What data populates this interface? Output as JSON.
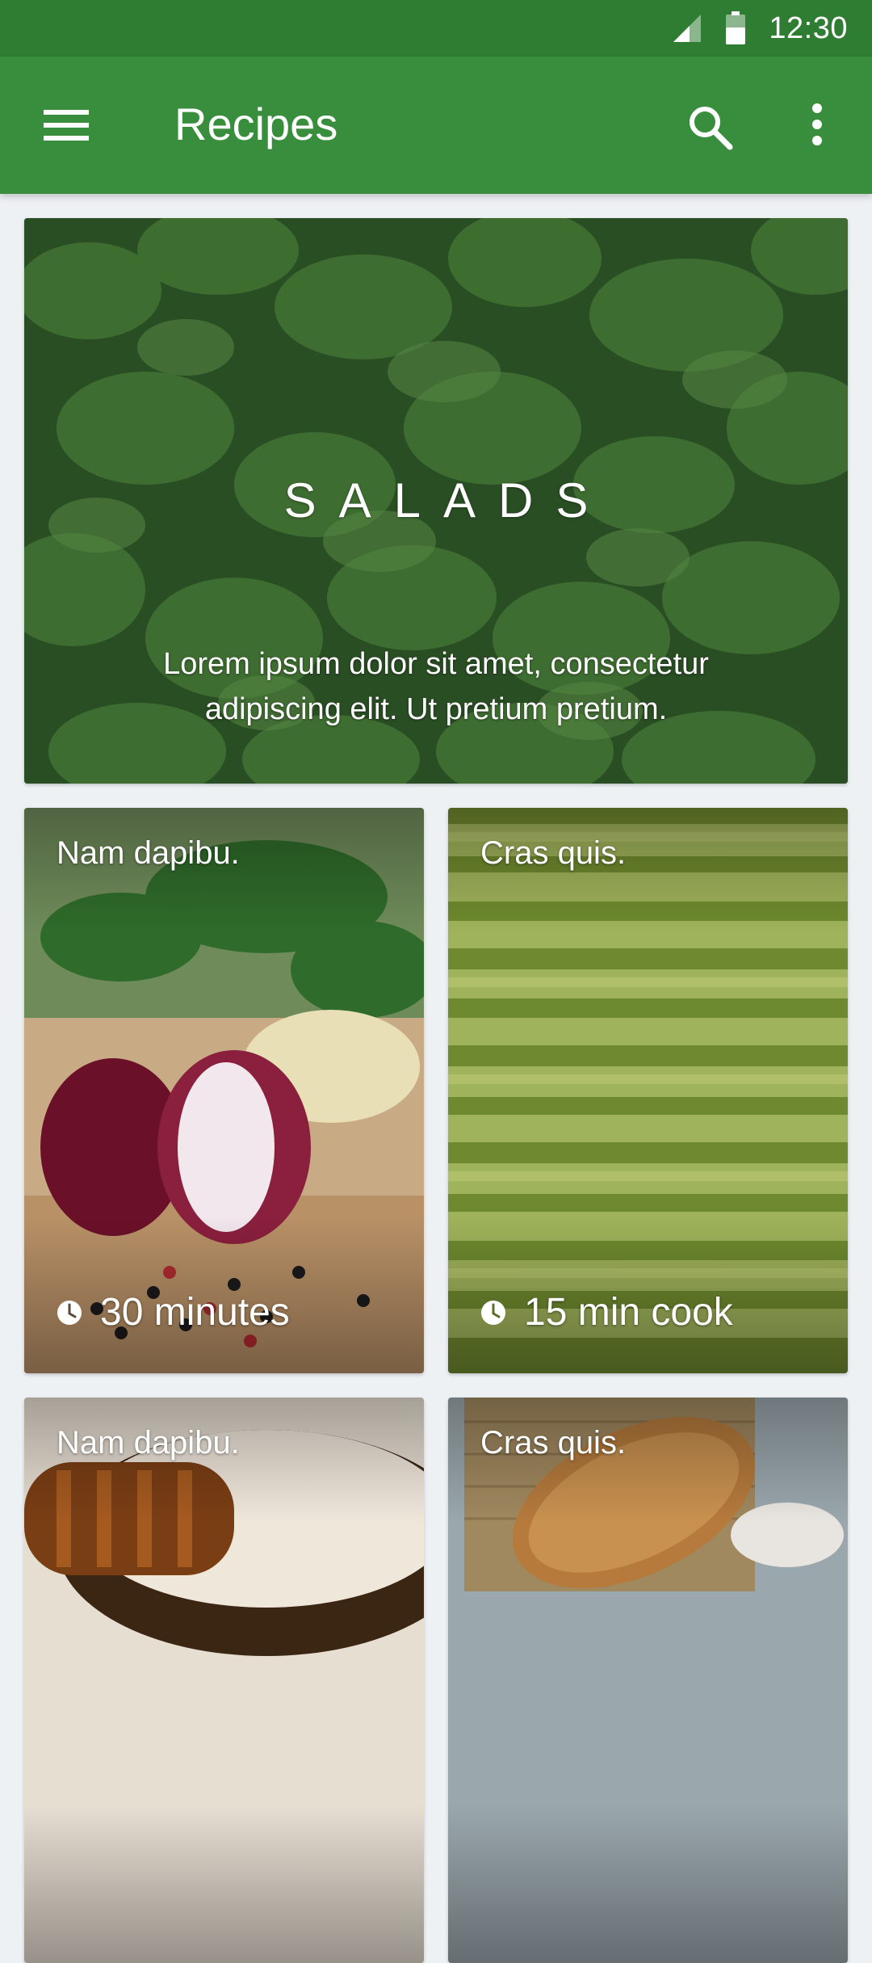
{
  "status_bar": {
    "time": "12:30",
    "icons": [
      "signal-icon",
      "battery-icon"
    ]
  },
  "app_bar": {
    "title": "Recipes",
    "icons": [
      "menu-icon",
      "search-icon",
      "more-vert-icon"
    ]
  },
  "hero": {
    "title": "SALADS",
    "description_line1": "Lorem ipsum dolor sit amet, consectetur",
    "description_line2": "adipiscing elit. Ut pretium pretium."
  },
  "tiles": [
    {
      "title": "Nam dapibu.",
      "meta": "30 minutes",
      "meta_icon": "clock-icon"
    },
    {
      "title": "Cras quis.",
      "meta": "15 min cook",
      "meta_icon": "clock-icon"
    },
    {
      "title": "Nam dapibu."
    },
    {
      "title": "Cras quis."
    }
  ],
  "colors": {
    "status_bar": "#2e7d32",
    "app_bar": "#388e3c",
    "background": "#eef1f3"
  }
}
